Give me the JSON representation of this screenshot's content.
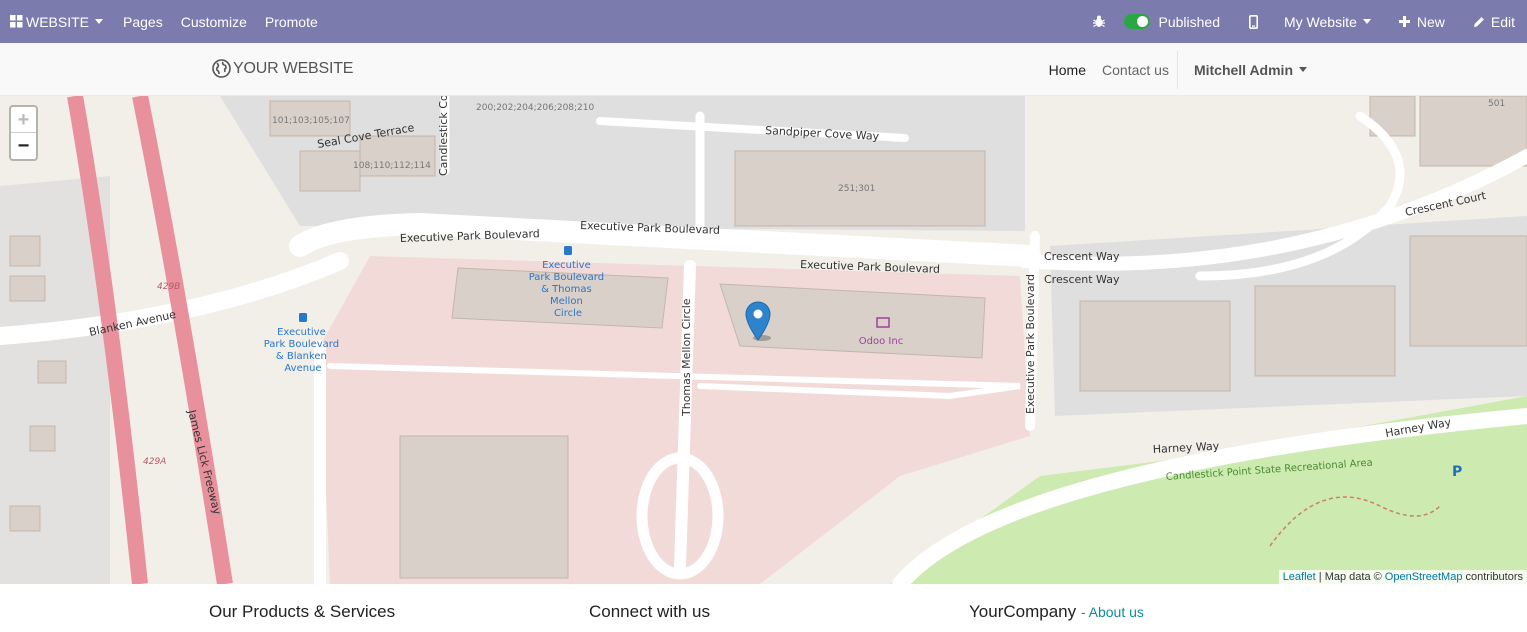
{
  "topbar": {
    "website_menu": "WEBSITE",
    "pages": "Pages",
    "customize": "Customize",
    "promote": "Promote",
    "published": "Published",
    "my_website": "My Website",
    "new": "New",
    "edit": "Edit",
    "icons": [
      "grid-icon",
      "bug-icon",
      "mobile-icon",
      "plus-icon",
      "pencil-icon"
    ],
    "bar_color": "#7c7bad",
    "published_on": true
  },
  "header": {
    "logo_text": "YOUR WEBSITE",
    "nav": [
      "Home",
      "Contact us"
    ],
    "active": "Home",
    "user": "Mitchell Admin"
  },
  "map": {
    "zoom_in": "+",
    "zoom_out": "−",
    "labels": {
      "exec_park_blvd": "Executive Park Boulevard",
      "sandpiper": "Sandpiper Cove Way",
      "seal_cove": "Seal Cove Terrace",
      "candlestick_cove": "Candlestick Cove",
      "crescent_way": "Crescent Way",
      "crescent_court": "Crescent Court",
      "harney_way": "Harney Way",
      "thomas_mellon": "Thomas Mellon Circle",
      "james_lick": "James Lick Freeway",
      "blanken": "Blanken Avenue",
      "candlestick_park": "Candlestick Point State Recreational Area",
      "odoo_inc": "Odoo Inc",
      "bus_stop_1": [
        "Executive",
        "Park Boulevard",
        "& Thomas",
        "Mellon",
        "Circle"
      ],
      "bus_stop_2": [
        "Executive",
        "Park Boulevard",
        "& Blanken",
        "Avenue"
      ],
      "addr_1": "200;202;204;206;208;210",
      "addr_2": "101;103;105;107",
      "addr_3": "108;110;112;114",
      "addr_4": "251;301",
      "addr_5": "501",
      "hwy_1": "429B",
      "hwy_2": "429A"
    },
    "attribution": {
      "leaflet": "Leaflet",
      "separator": "| Map data ©",
      "osm": "OpenStreetMap",
      "contributors": "contributors"
    }
  },
  "footer": {
    "col1": "Our Products & Services",
    "col2": "Connect with us",
    "col3": "YourCompany",
    "col3_link": "- About us"
  }
}
